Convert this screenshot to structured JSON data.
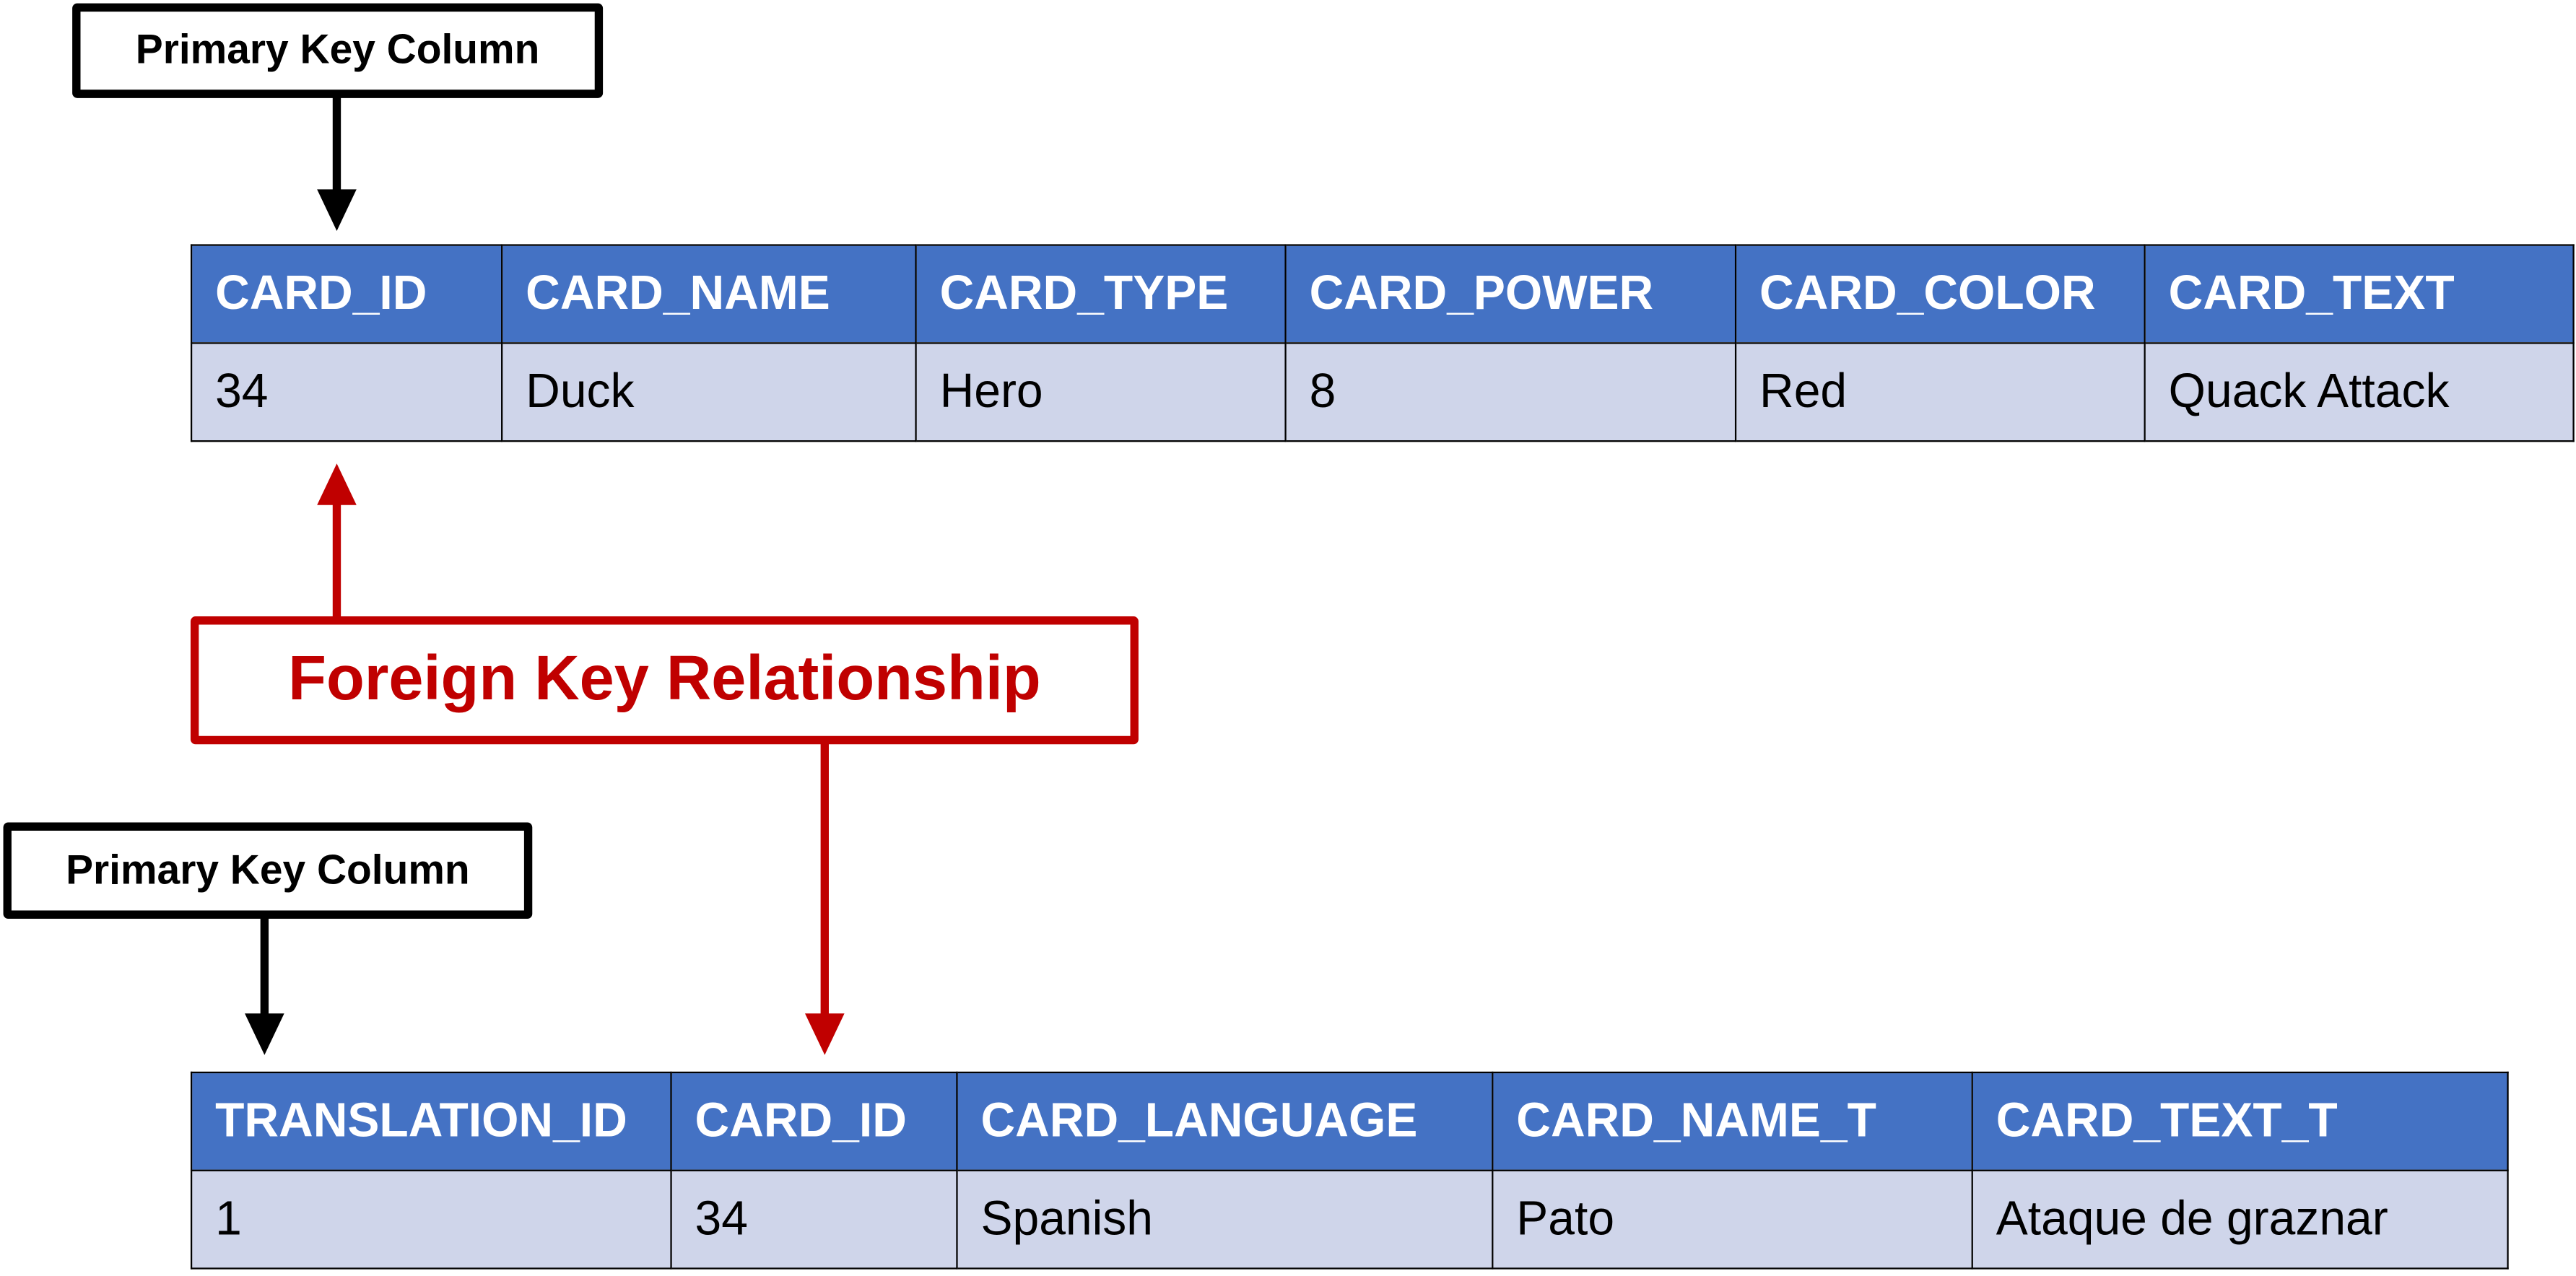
{
  "labels": {
    "primary_key_top": "Primary Key Column",
    "primary_key_bottom": "Primary Key Column",
    "foreign_key": "Foreign Key Relationship"
  },
  "colors": {
    "header": "#4472C4",
    "row": "#CFD5EA",
    "foreign_key": "#C00000",
    "primary_key": "#000000"
  },
  "cards_table": {
    "columns": [
      "CARD_ID",
      "CARD_NAME",
      "CARD_TYPE",
      "CARD_POWER",
      "CARD_COLOR",
      "CARD_TEXT"
    ],
    "rows": [
      [
        "34",
        "Duck",
        "Hero",
        "8",
        "Red",
        "Quack Attack"
      ]
    ]
  },
  "translations_table": {
    "columns": [
      "TRANSLATION_ID",
      "CARD_ID",
      "CARD_LANGUAGE",
      "CARD_NAME_T",
      "CARD_TEXT_T"
    ],
    "rows": [
      [
        "1",
        "34",
        "Spanish",
        "Pato",
        "Ataque de graznar"
      ]
    ]
  }
}
